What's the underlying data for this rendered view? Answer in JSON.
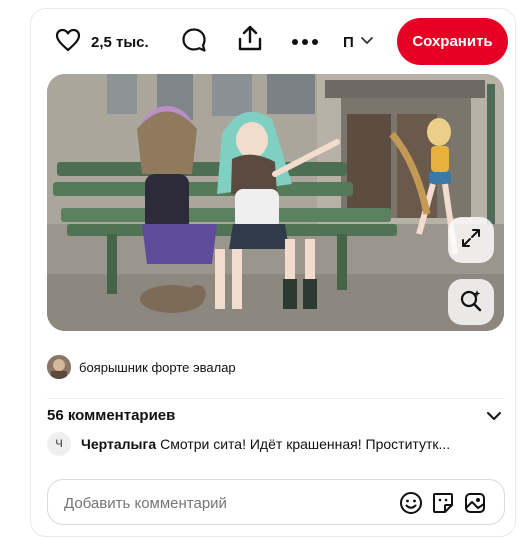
{
  "toolbar": {
    "like_count": "2,5 тыс.",
    "board_label": "П",
    "save_label": "Сохранить"
  },
  "image": {
    "description_icons": [
      "expand-icon",
      "visual-search-icon"
    ]
  },
  "author": {
    "name": "боярышник форте эвалар"
  },
  "comments": {
    "title": "56 комментариев",
    "items": [
      {
        "avatar_letter": "Ч",
        "author": "Черталыга",
        "text": "Смотри сита! Идёт крашенная! Проститутк..."
      }
    ]
  },
  "input": {
    "placeholder": "Добавить комментарий"
  },
  "colors": {
    "accent": "#e60023",
    "text": "#111111",
    "muted": "#767676"
  },
  "icons": [
    "heart-icon",
    "comment-icon",
    "share-icon",
    "more-icon",
    "chevron-down-icon",
    "expand-icon",
    "visual-search-icon",
    "emoji-icon",
    "sticker-icon",
    "image-icon"
  ]
}
